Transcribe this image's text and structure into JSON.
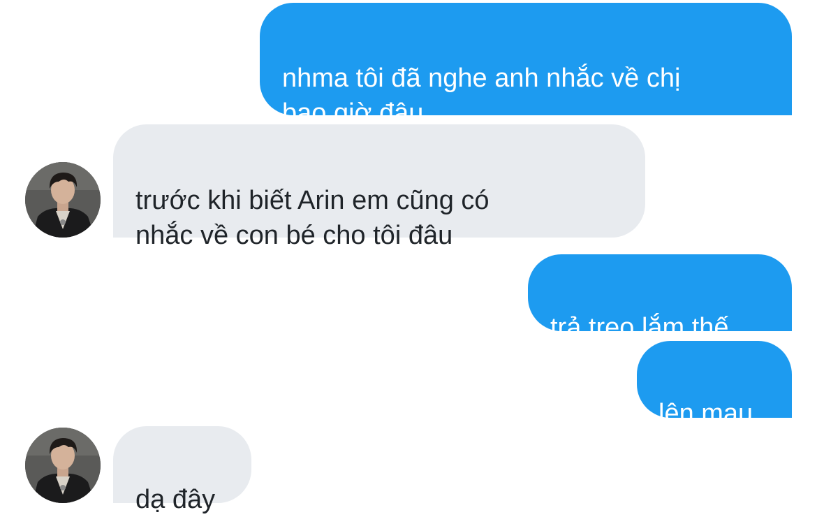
{
  "conversation": {
    "messages": [
      {
        "direction": "sent",
        "text": "nhma tôi đã nghe anh nhắc về chị\nbao giờ đâu"
      },
      {
        "direction": "received",
        "text": "trước khi biết Arin em cũng có\nnhắc về con bé cho tôi đâu"
      },
      {
        "direction": "sent",
        "text": "trả treo lắm thế"
      },
      {
        "direction": "sent",
        "text": "lên mau"
      },
      {
        "direction": "received",
        "text": "dạ đây"
      }
    ]
  },
  "colors": {
    "sent_bubble": "#1d9bf0",
    "received_bubble": "#e8ebef",
    "sent_text": "#ffffff",
    "received_text": "#1f2429",
    "background": "#ffffff"
  }
}
